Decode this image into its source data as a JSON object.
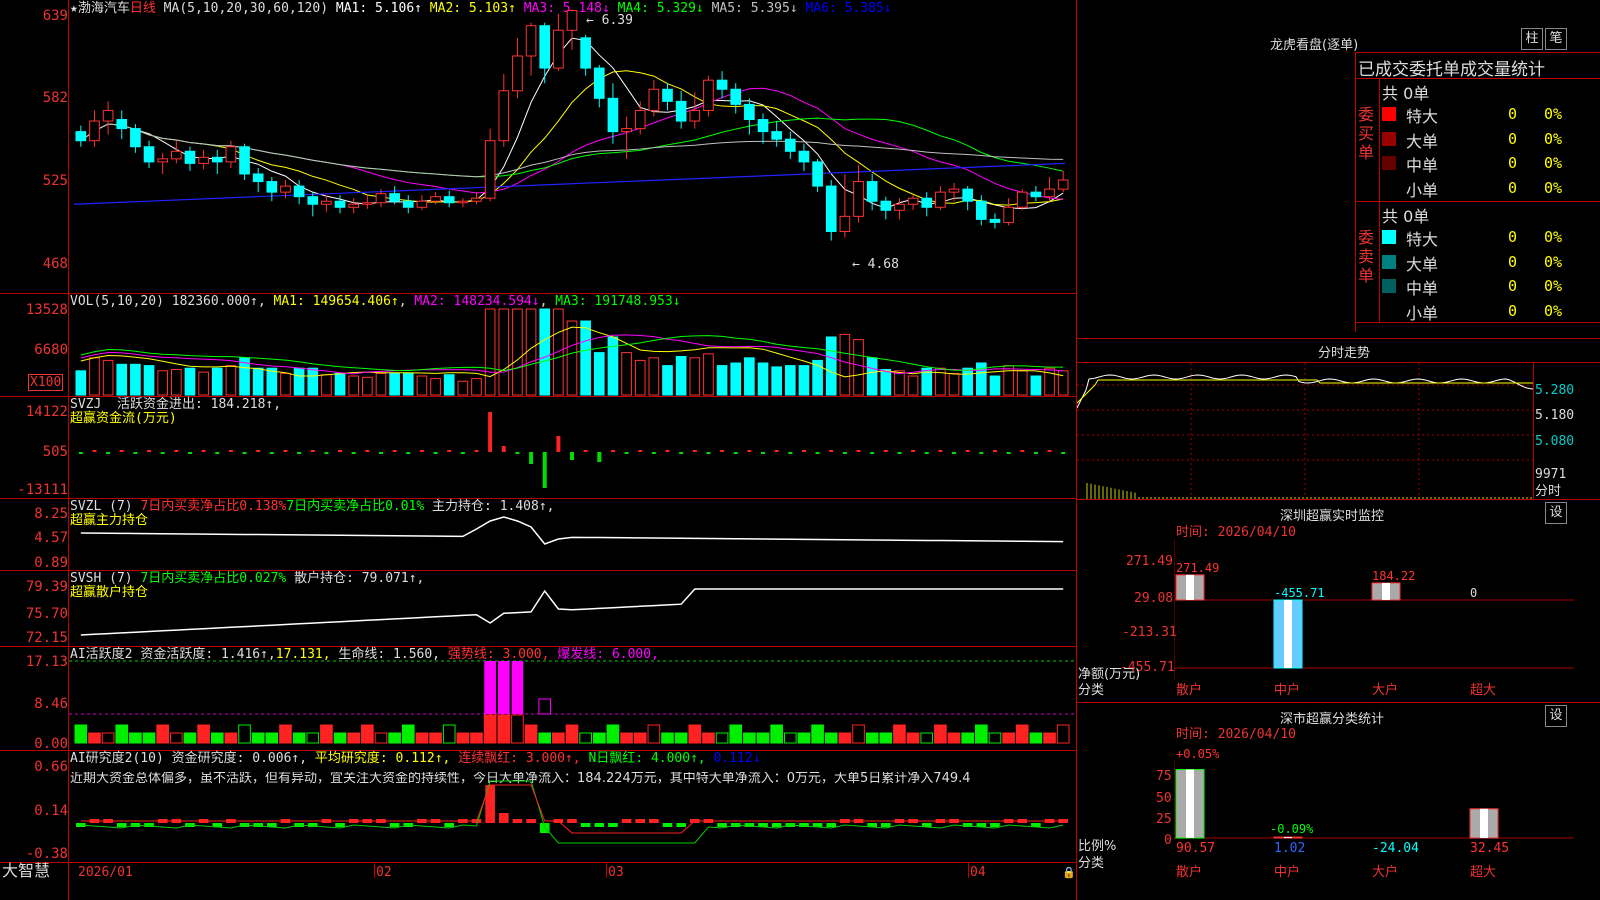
{
  "stock": {
    "name": "★渤海汽车",
    "period": "日线",
    "ma_label": "MA(5,10,20,30,60,120)"
  },
  "ma": [
    {
      "text": "MA1: 5.106↑",
      "color": "#ffffff"
    },
    {
      "text": "MA2: 5.103↑",
      "color": "#ffff00"
    },
    {
      "text": "MA3: 5.148↓",
      "color": "#ff00ff"
    },
    {
      "text": "MA4: 5.329↓",
      "color": "#00ff00"
    },
    {
      "text": "MA5: 5.395↓",
      "color": "#c0c0c0"
    },
    {
      "text": "MA6: 5.385↓",
      "color": "#0000ff"
    }
  ],
  "price_axis": [
    "639",
    "582",
    "525",
    "468"
  ],
  "price_high": "6.39",
  "price_low": "4.68",
  "vol": {
    "title": "VOL(5,10,20)",
    "value": "182360.000↑",
    "ma1": "MA1: 149654.406↑",
    "ma2": "MA2: 148234.594↓",
    "ma3": "MA3: 191748.953↓",
    "axis": [
      "13528",
      "6680",
      "X100"
    ]
  },
  "svzj": {
    "title": "SVZJ",
    "line1": "活跃资金进出: 184.218↑,",
    "line2": "超赢资金流(万元)",
    "axis": [
      "14122",
      "505",
      "-13111"
    ]
  },
  "svzl": {
    "title": "SVZL (7)",
    "t1": "7日内买卖净占比0.138%",
    "t2": "7日内买卖净占比0.01%",
    "t3": "主力持仓: 1.408↑,",
    "line2": "超赢主力持仓",
    "axis": [
      "8.25",
      "4.57",
      "0.89"
    ]
  },
  "svsh": {
    "title": "SVSH (7)",
    "t1": "7日内买卖净占比0.027%",
    "t2": "散户持仓: 79.071↑,",
    "line2": "超赢散户持仓",
    "axis": [
      "79.39",
      "75.70",
      "72.15"
    ]
  },
  "ai1": {
    "title": "AI活跃度2",
    "t1": "资金活跃度: 1.416↑,",
    "t2": "17.131,",
    "t3": "生命线: 1.560,",
    "t4": "强势线: 3.000,",
    "t5": "爆发线: 6.000,",
    "axis": [
      "17.13",
      "8.46",
      "0.00"
    ]
  },
  "ai2": {
    "title": "AI研究度2(10)",
    "t1": "资金研究度: 0.006↑,",
    "t2": "平均研究度: 0.112↑,",
    "t3": "连续飘红: 3.000↑,",
    "t4": "N日飘红: 4.000↑,",
    "t5": "0.112↓",
    "text": "近期大资金总体偏多，虽不活跃，但有异动，宜关注大资金的持续性，今日大单净流入：184.224万元，其中特大单净流入：0万元，大单5日累计净入749.4",
    "axis": [
      "0.66",
      "0.14",
      "-0.38"
    ]
  },
  "dates": [
    "2026/01",
    "02",
    "03",
    "04"
  ],
  "brand": "大智慧",
  "lhb": {
    "title": "龙虎看盘(逐单)",
    "btn1": "柱",
    "btn2": "笔",
    "subtitle": "已成交委托单成交量统计",
    "buy": {
      "side": "委买单",
      "total": "共 0单",
      "rows": [
        {
          "label": "特大",
          "val": "0",
          "pct": "0%",
          "color": "#ff0000"
        },
        {
          "label": "大单",
          "val": "0",
          "pct": "0%",
          "color": "#990000"
        },
        {
          "label": "中单",
          "val": "0",
          "pct": "0%",
          "color": "#660000"
        },
        {
          "label": "小单",
          "val": "0",
          "pct": "0%",
          "color": "#000000"
        }
      ]
    },
    "sell": {
      "side": "委卖单",
      "total": "共 0单",
      "rows": [
        {
          "label": "特大",
          "val": "0",
          "pct": "0%",
          "color": "#00ffff"
        },
        {
          "label": "大单",
          "val": "0",
          "pct": "0%",
          "color": "#008080"
        },
        {
          "label": "中单",
          "val": "0",
          "pct": "0%",
          "color": "#006060"
        },
        {
          "label": "小单",
          "val": "0",
          "pct": "0%",
          "color": "#000000"
        }
      ]
    }
  },
  "fenshi": {
    "title": "分时走势",
    "axis": [
      "5.280",
      "5.180",
      "5.080",
      "9971",
      "分时"
    ]
  },
  "sz_monitor": {
    "title": "深圳超赢实时监控",
    "btn": "设",
    "time": "时间: 2026/04/10",
    "axis": [
      "271.49",
      "29.08",
      "-213.31",
      "-455.71"
    ],
    "ylabel": "净额(万元)",
    "xlabel": "分类",
    "bars": [
      {
        "cat": "散户",
        "value": 271.49,
        "label": "271.49"
      },
      {
        "cat": "中户",
        "value": -455.71,
        "label": "-455.71"
      },
      {
        "cat": "大户",
        "value": 184.22,
        "label": "184.22"
      },
      {
        "cat": "超大",
        "value": 0,
        "label": "0"
      }
    ]
  },
  "sz_class": {
    "title": "深市超赢分类统计",
    "btn": "设",
    "time": "时间: 2026/04/10",
    "axis": [
      "75",
      "50",
      "25",
      "0"
    ],
    "ylabel": "比例%",
    "xlabel": "分类",
    "bars": [
      {
        "cat": "散户",
        "value": 90.57,
        "label": "90.57",
        "top": "+0.05%"
      },
      {
        "cat": "中户",
        "value": 1.02,
        "label": "1.02",
        "top": "-0.09%"
      },
      {
        "cat": "大户",
        "value": -24.04,
        "label": "-24.04",
        "top": ""
      },
      {
        "cat": "超大",
        "value": 32.45,
        "label": "32.45",
        "top": ""
      }
    ]
  },
  "chart_data": {
    "type": "candlestick",
    "ylim": [
      468,
      639
    ],
    "candles": [
      [
        558,
        552,
        562,
        548
      ],
      [
        552,
        565,
        572,
        548
      ],
      [
        565,
        572,
        578,
        556
      ],
      [
        566,
        560,
        572,
        553
      ],
      [
        560,
        548,
        563,
        544
      ],
      [
        548,
        538,
        552,
        534
      ],
      [
        538,
        540,
        544,
        530
      ],
      [
        540,
        545,
        552,
        537
      ],
      [
        545,
        537,
        548,
        532
      ],
      [
        537,
        541,
        546,
        533
      ],
      [
        541,
        538,
        546,
        530
      ],
      [
        538,
        548,
        552,
        534
      ],
      [
        548,
        530,
        550,
        526
      ],
      [
        530,
        525,
        534,
        518
      ],
      [
        525,
        518,
        528,
        512
      ],
      [
        518,
        522,
        526,
        514
      ],
      [
        522,
        515,
        526,
        510
      ],
      [
        515,
        510,
        518,
        502
      ],
      [
        510,
        512,
        516,
        505
      ],
      [
        512,
        508,
        516,
        504
      ],
      [
        508,
        510,
        514,
        504
      ],
      [
        510,
        511,
        516,
        507
      ],
      [
        511,
        517,
        520,
        508
      ],
      [
        517,
        512,
        522,
        510
      ],
      [
        512,
        508,
        516,
        504
      ],
      [
        508,
        512,
        516,
        506
      ],
      [
        512,
        515,
        518,
        510
      ],
      [
        515,
        511,
        519,
        508
      ],
      [
        511,
        512,
        514,
        508
      ],
      [
        512,
        514,
        518,
        510
      ],
      [
        514,
        552,
        560,
        512
      ],
      [
        552,
        585,
        596,
        548
      ],
      [
        585,
        608,
        620,
        580
      ],
      [
        608,
        628,
        630,
        595
      ],
      [
        628,
        600,
        630,
        590
      ],
      [
        600,
        625,
        636,
        598
      ],
      [
        625,
        638,
        639,
        612
      ],
      [
        620,
        600,
        622,
        595
      ],
      [
        600,
        580,
        602,
        574
      ],
      [
        580,
        558,
        590,
        550
      ],
      [
        558,
        560,
        568,
        540
      ],
      [
        560,
        572,
        578,
        556
      ],
      [
        572,
        586,
        592,
        568
      ],
      [
        586,
        578,
        590,
        572
      ],
      [
        578,
        565,
        585,
        560
      ],
      [
        565,
        572,
        584,
        560
      ],
      [
        572,
        592,
        595,
        568
      ],
      [
        592,
        586,
        598,
        580
      ],
      [
        586,
        576,
        590,
        570
      ],
      [
        576,
        566,
        580,
        556
      ],
      [
        566,
        558,
        570,
        550
      ],
      [
        558,
        553,
        565,
        548
      ],
      [
        553,
        545,
        558,
        540
      ],
      [
        545,
        538,
        550,
        532
      ],
      [
        538,
        522,
        540,
        518
      ],
      [
        522,
        492,
        526,
        486
      ],
      [
        492,
        502,
        530,
        488
      ],
      [
        502,
        525,
        536,
        498
      ],
      [
        525,
        512,
        530,
        506
      ],
      [
        512,
        506,
        515,
        500
      ],
      [
        506,
        510,
        514,
        500
      ],
      [
        510,
        514,
        516,
        506
      ],
      [
        514,
        508,
        518,
        502
      ],
      [
        508,
        518,
        522,
        506
      ],
      [
        518,
        520,
        524,
        512
      ],
      [
        520,
        512,
        522,
        506
      ],
      [
        512,
        500,
        516,
        496
      ],
      [
        500,
        498,
        504,
        494
      ],
      [
        498,
        508,
        514,
        496
      ],
      [
        508,
        518,
        520,
        506
      ],
      [
        518,
        515,
        522,
        512
      ],
      [
        515,
        520,
        528,
        512
      ],
      [
        520,
        526,
        532,
        518
      ]
    ]
  }
}
